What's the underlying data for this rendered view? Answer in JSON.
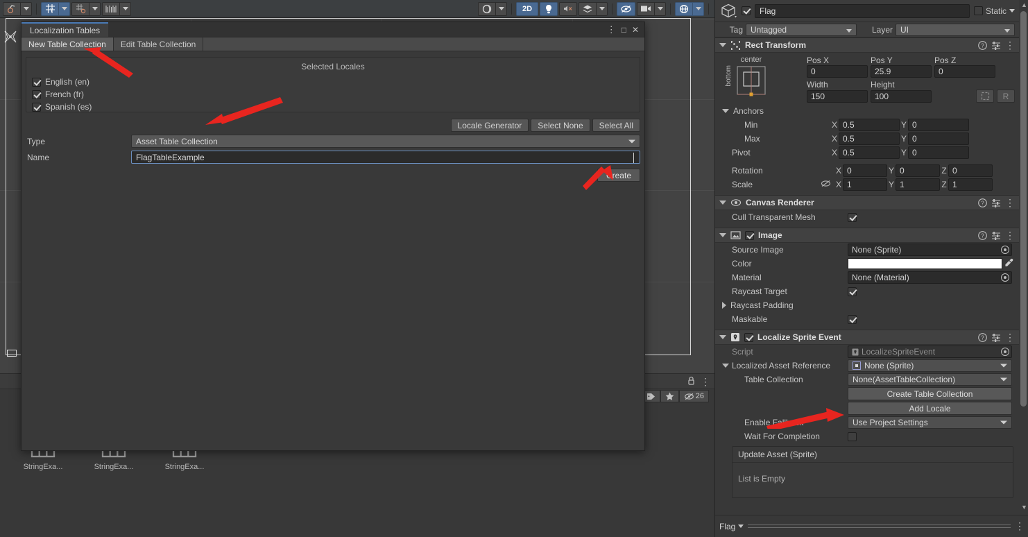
{
  "scene_toolbar": {
    "items": [
      {
        "name": "pivot-tool",
        "icon": "pivot",
        "active": false
      },
      {
        "name": "pivot-dropdown",
        "icon": "chevron-down-icon",
        "active": false
      },
      {
        "name": "grid-snap-toggle",
        "icon": "grid-snap",
        "active": true
      },
      {
        "name": "grid-snap-dropdown",
        "icon": "chevron-down-icon",
        "active": true
      },
      {
        "name": "snap-increment",
        "icon": "snap-increment",
        "active": false
      },
      {
        "name": "snap-increment-dropdown",
        "icon": "chevron-down-icon",
        "active": false
      },
      {
        "name": "ruler-tool",
        "icon": "ruler",
        "active": false
      },
      {
        "name": "ruler-dropdown",
        "icon": "chevron-down-icon",
        "active": false
      }
    ],
    "right_items": [
      {
        "name": "shading-mode",
        "icon": "sphere",
        "label": "",
        "active": false
      },
      {
        "name": "shading-dropdown",
        "icon": "chevron-down-icon",
        "active": false
      },
      {
        "name": "2d-toggle",
        "icon": "",
        "label": "2D",
        "active": true
      },
      {
        "name": "lighting-toggle",
        "icon": "lightbulb",
        "active": true
      },
      {
        "name": "audio-toggle",
        "icon": "speaker-mute",
        "active": false
      },
      {
        "name": "effects-toggle",
        "icon": "effects",
        "active": false
      },
      {
        "name": "effects-dropdown",
        "icon": "chevron-down-icon",
        "active": false
      },
      {
        "name": "scene-visibility-toggle",
        "icon": "eye-slash",
        "active": true
      },
      {
        "name": "camera-toggle",
        "icon": "camera",
        "active": false
      },
      {
        "name": "camera-dropdown",
        "icon": "chevron-down-icon",
        "active": false
      },
      {
        "name": "gizmos-toggle",
        "icon": "gizmo-globe",
        "active": true
      },
      {
        "name": "gizmos-dropdown",
        "icon": "chevron-down-icon",
        "active": true
      }
    ]
  },
  "loc_window": {
    "tab_title": "Localization Tables",
    "window_buttons": {
      "menu": "⋮",
      "maximize": "□",
      "close": "✕"
    },
    "mode_tabs": [
      {
        "label": "New Table Collection",
        "active": true
      },
      {
        "label": "Edit Table Collection",
        "active": false
      }
    ],
    "locales_title": "Selected Locales",
    "locales": [
      {
        "label": "English (en)",
        "checked": true
      },
      {
        "label": "French (fr)",
        "checked": true
      },
      {
        "label": "Spanish (es)",
        "checked": true
      }
    ],
    "locale_buttons": [
      "Locale Generator",
      "Select None",
      "Select All"
    ],
    "type_label": "Type",
    "type_value": "Asset Table Collection",
    "name_label": "Name",
    "name_value": "FlagTableExample",
    "create_label": "Create"
  },
  "project": {
    "lock_icon": "lock-icon",
    "menu_icon": "kebab-menu-icon",
    "sub_buttons": [
      {
        "name": "label-filter-button",
        "icon": "tag-icon",
        "text": ""
      },
      {
        "name": "favorite-filter-button",
        "icon": "star-icon",
        "text": ""
      },
      {
        "name": "hidden-count-button",
        "icon": "eye-slash-icon",
        "text": "26"
      }
    ],
    "assets": [
      {
        "label": "StringExa...",
        "icon": "table-asset-icon"
      },
      {
        "label": "StringExa...",
        "icon": "table-asset-icon"
      },
      {
        "label": "StringExa...",
        "icon": "table-asset-icon"
      }
    ]
  },
  "inspector": {
    "gameobject": {
      "icon": "cube-icon",
      "enabled": true,
      "name": "Flag",
      "static_label": "Static",
      "static_checked": false,
      "tag_label": "Tag",
      "tag_value": "Untagged",
      "layer_label": "Layer",
      "layer_value": "UI"
    },
    "rect_transform": {
      "title": "Rect Transform",
      "anchor_preset_top": "center",
      "anchor_preset_side": "bottom",
      "fields": [
        {
          "label": "Pos X",
          "value": "0"
        },
        {
          "label": "Pos Y",
          "value": "25.9"
        },
        {
          "label": "Pos Z",
          "value": "0"
        },
        {
          "label": "Width",
          "value": "150"
        },
        {
          "label": "Height",
          "value": "100"
        }
      ],
      "blueprint_label": "",
      "raw_label": "R",
      "anchors_label": "Anchors",
      "anchors": [
        {
          "label": "Min",
          "x": "0.5",
          "y": "0"
        },
        {
          "label": "Max",
          "x": "0.5",
          "y": "0"
        }
      ],
      "pivot": {
        "label": "Pivot",
        "x": "0.5",
        "y": "0"
      },
      "rotation": {
        "label": "Rotation",
        "x": "0",
        "y": "0",
        "z": "0"
      },
      "scale": {
        "label": "Scale",
        "x": "1",
        "y": "1",
        "z": "1",
        "link_icon": "link-broken-icon"
      }
    },
    "canvas_renderer": {
      "title": "Canvas Renderer",
      "icon": "eye-icon",
      "cull_label": "Cull Transparent Mesh",
      "cull_checked": true
    },
    "image": {
      "title": "Image",
      "icon": "image-icon",
      "enabled": true,
      "rows": [
        {
          "label": "Source Image",
          "value": "None (Sprite)",
          "type": "object"
        },
        {
          "label": "Color",
          "value": "#FFFFFF",
          "type": "color"
        },
        {
          "label": "Material",
          "value": "None (Material)",
          "type": "object"
        },
        {
          "label": "Raycast Target",
          "value": "",
          "type": "checkbox",
          "checked": true
        },
        {
          "label": "Raycast Padding",
          "value": "",
          "type": "foldout"
        },
        {
          "label": "Maskable",
          "value": "",
          "type": "checkbox",
          "checked": true
        }
      ]
    },
    "localize_sprite_event": {
      "title": "Localize Sprite Event",
      "icon": "localize-icon",
      "enabled": true,
      "script_label": "Script",
      "script_value": "LocalizeSpriteEvent",
      "asset_ref_label": "Localized Asset Reference",
      "asset_ref_value": "None (Sprite)",
      "table_collection_label": "Table Collection",
      "table_collection_value": "None(AssetTableCollection)",
      "create_table_button": "Create Table Collection",
      "add_locale_button": "Add Locale",
      "enable_fallback_label": "Enable Fallback",
      "enable_fallback_value": "Use Project Settings",
      "wait_label": "Wait For Completion",
      "wait_checked": false,
      "event_title": "Update Asset (Sprite)",
      "event_empty": "List is Empty"
    },
    "footer": {
      "asset_name": "Flag",
      "menu_icon": "kebab-menu-icon"
    }
  },
  "colors": {
    "accent_blue": "#4a7ab5",
    "panel_bg": "#393939",
    "window_bg": "#383838",
    "annotation_red": "#e8251f"
  }
}
